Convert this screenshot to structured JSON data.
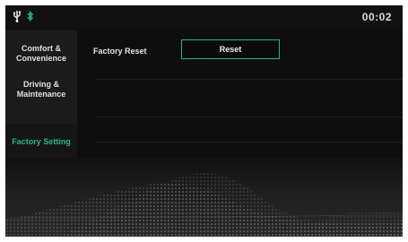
{
  "status_bar": {
    "clock": "00:02",
    "icons": [
      "usb-icon",
      "bluetooth-icon"
    ]
  },
  "sidebar": {
    "items": [
      {
        "label": "Comfort & Convenience",
        "active": false
      },
      {
        "label": "Driving & Maintenance",
        "active": false
      },
      {
        "label": "Factory Setting",
        "active": true
      }
    ]
  },
  "content": {
    "factory_reset_label": "Factory Reset",
    "reset_button_label": "Reset"
  },
  "colors": {
    "accent": "#2ab882",
    "background": "#0d0d0d",
    "sidebar": "#1b1b1b"
  }
}
